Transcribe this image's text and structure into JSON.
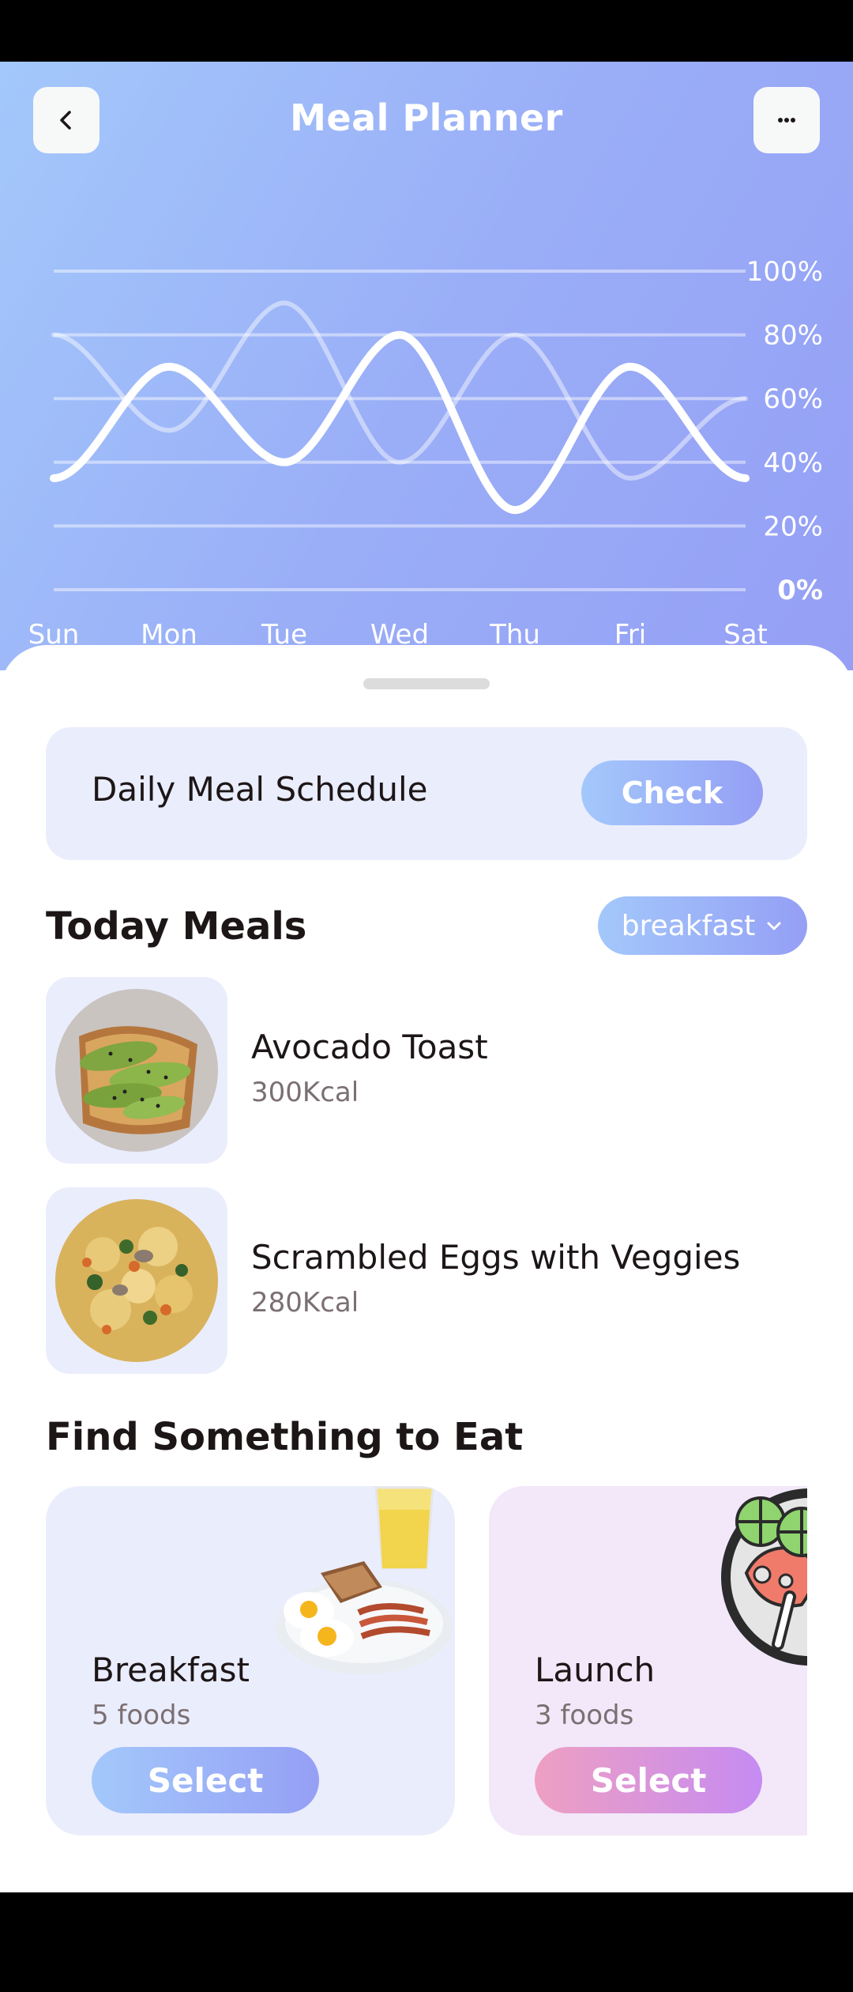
{
  "header": {
    "title": "Meal Planner",
    "back_icon": "chevron-left-icon",
    "more_icon": "more-dots-icon"
  },
  "chart_data": {
    "type": "line",
    "x": [
      "Sun",
      "Mon",
      "Tue",
      "Wed",
      "Thu",
      "Fri",
      "Sat"
    ],
    "y_ticks": [
      "100%",
      "80%",
      "60%",
      "40%",
      "20%",
      "0%"
    ],
    "ylim": [
      0,
      100
    ],
    "grid": true,
    "series": [
      {
        "values": [
          35,
          70,
          40,
          80,
          25,
          70,
          35
        ],
        "color": "#ffffff"
      },
      {
        "values": [
          80,
          50,
          90,
          40,
          80,
          35,
          60
        ],
        "color": "rgba(255,255,255,0.45)"
      }
    ]
  },
  "schedule": {
    "label": "Daily Meal Schedule",
    "button": "Check"
  },
  "today": {
    "title": "Today Meals",
    "dropdown": "breakfast",
    "meals": [
      {
        "name": "Avocado Toast",
        "kcal": "300Kcal"
      },
      {
        "name": "Scrambled Eggs with Veggies",
        "kcal": "280Kcal"
      }
    ]
  },
  "find": {
    "title": "Find Something to Eat",
    "cards": [
      {
        "name": "Breakfast",
        "count": "5 foods",
        "button": "Select"
      },
      {
        "name": "Launch",
        "count": "3 foods",
        "button": "Select"
      }
    ]
  },
  "colors": {
    "brand_blue_start": "#a3c8fb",
    "brand_blue_end": "#959ff5",
    "brand_pink_start": "#ee9fc2",
    "brand_pink_end": "#c58bf2"
  }
}
